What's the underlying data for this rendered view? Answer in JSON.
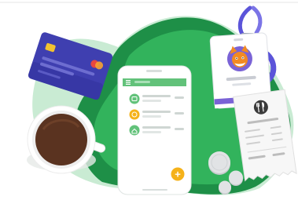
{
  "colors": {
    "background": "#ffffff",
    "blob_dark": "#1e8f47",
    "blob_light": "#32b35c",
    "blob_shadow": "#c9ebd3",
    "card": "#3f3fb0",
    "card_dark": "#30309a",
    "chip": "#f2c230",
    "mastercard_red": "#e9473f",
    "mastercard_orange": "#f7a331",
    "phone_body": "#ffffff",
    "phone_header": "#62c27a",
    "accent_orange": "#f5b21a",
    "fab": "#f5b21a",
    "badge_purple": "#7a63d6",
    "lanyard": "#5b54d9",
    "mascot_orange": "#f28a22",
    "receipt": "#f7f7f7",
    "receipt_icon": "#3b3b3b",
    "coin": "#d7d9dc",
    "coffee": "#5a3320",
    "cup": "#ffffff"
  },
  "icons": {
    "menu": "hamburger-icon",
    "row1": "card-icon",
    "row2": "clock-icon",
    "row3": "home-icon",
    "fab": "plus-icon",
    "receipt": "fork-knife-icon",
    "mascot": "fox-mascot-icon"
  },
  "phone": {
    "list_rows": 3,
    "fab_label": "+"
  }
}
